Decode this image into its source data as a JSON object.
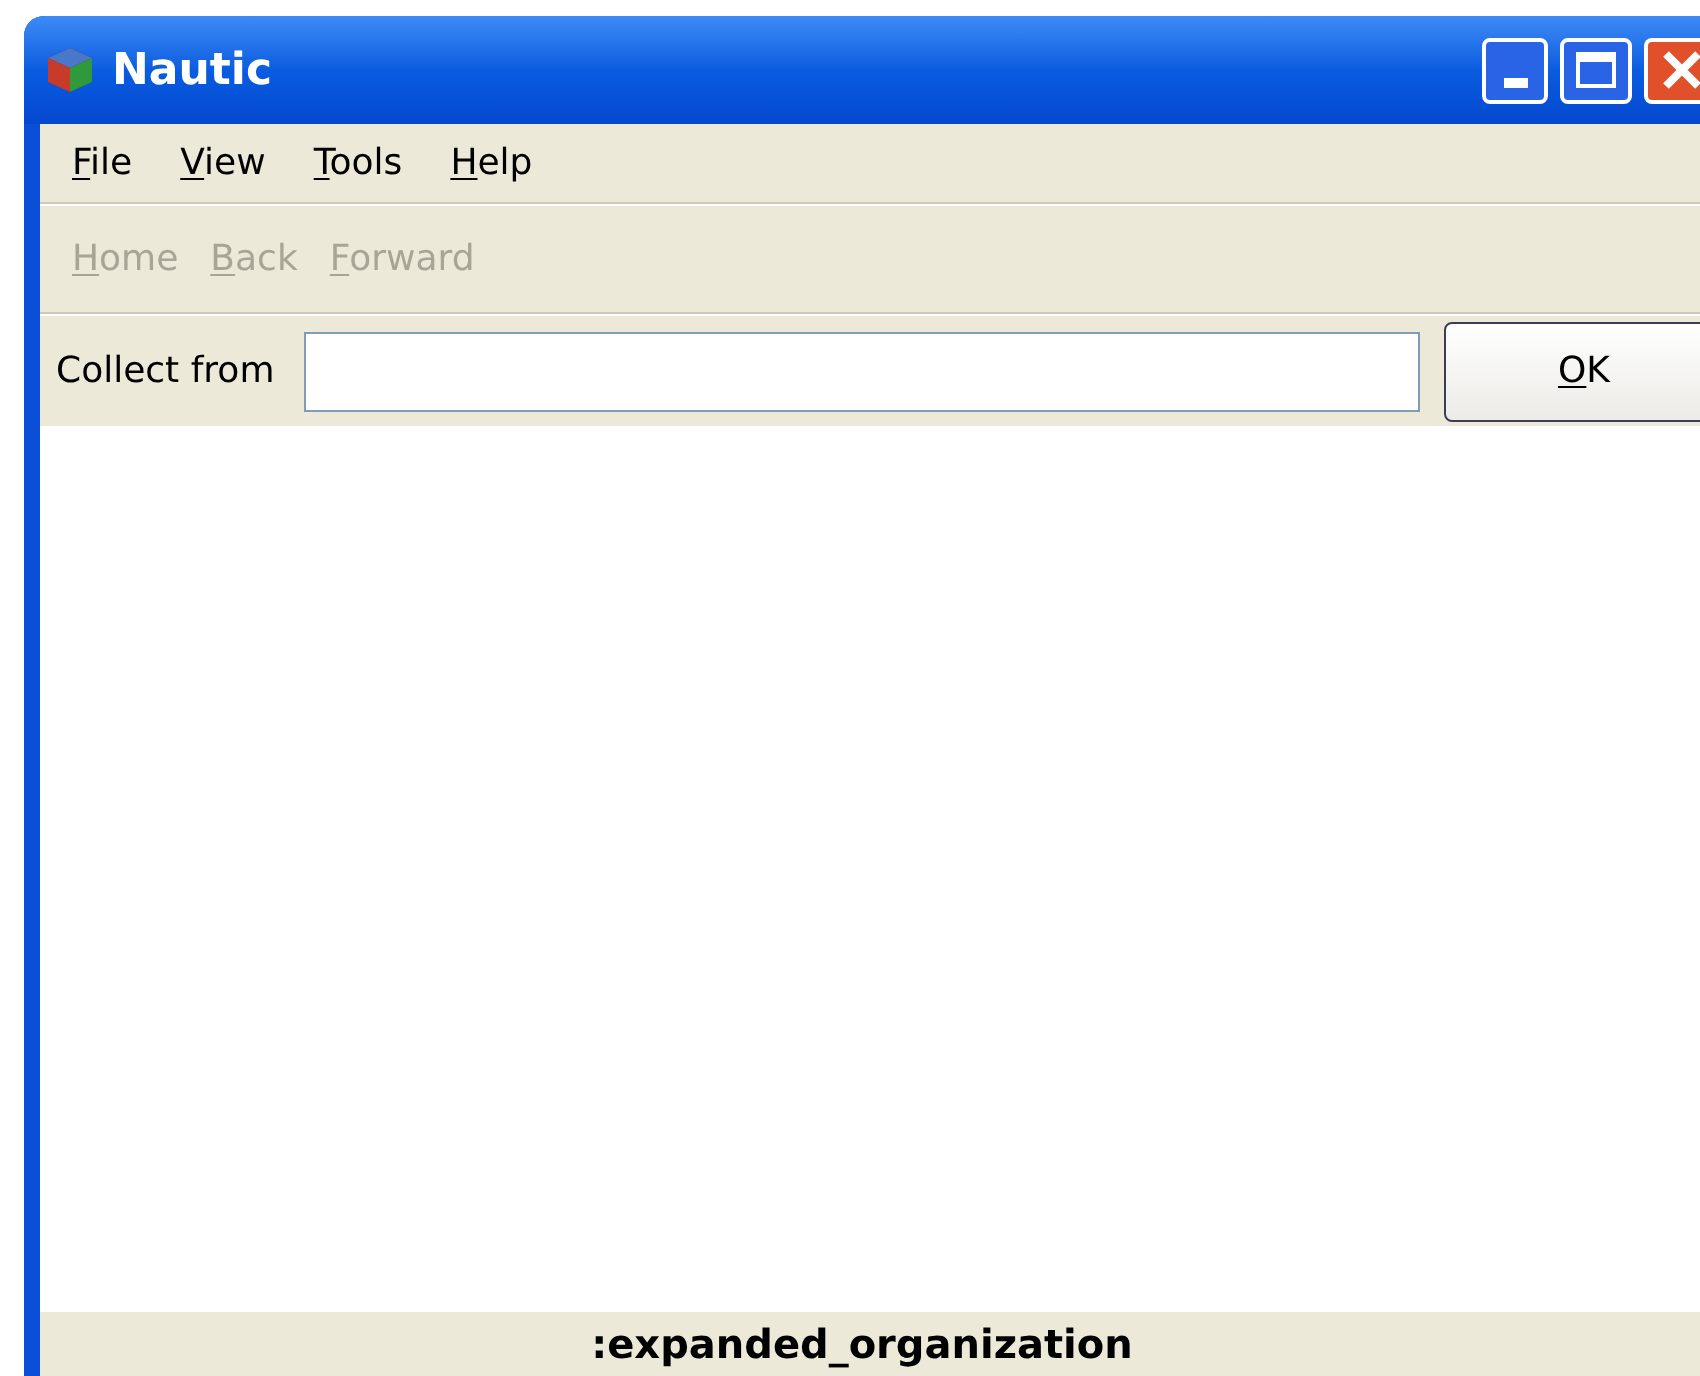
{
  "window": {
    "title": "Nautic"
  },
  "menu": [
    {
      "key": "F",
      "rest": "ile"
    },
    {
      "key": "V",
      "rest": "iew"
    },
    {
      "key": "T",
      "rest": "ools"
    },
    {
      "key": "H",
      "rest": "elp"
    }
  ],
  "toolbar": [
    {
      "key": "H",
      "rest": "ome",
      "disabled": true
    },
    {
      "key": "B",
      "rest": "ack",
      "disabled": true
    },
    {
      "key": "F",
      "rest": "orward",
      "disabled": true
    }
  ],
  "collect": {
    "label": "Collect from",
    "ok": {
      "key": "O",
      "rest": "K"
    }
  },
  "status_bar": ":expanded_organization"
}
